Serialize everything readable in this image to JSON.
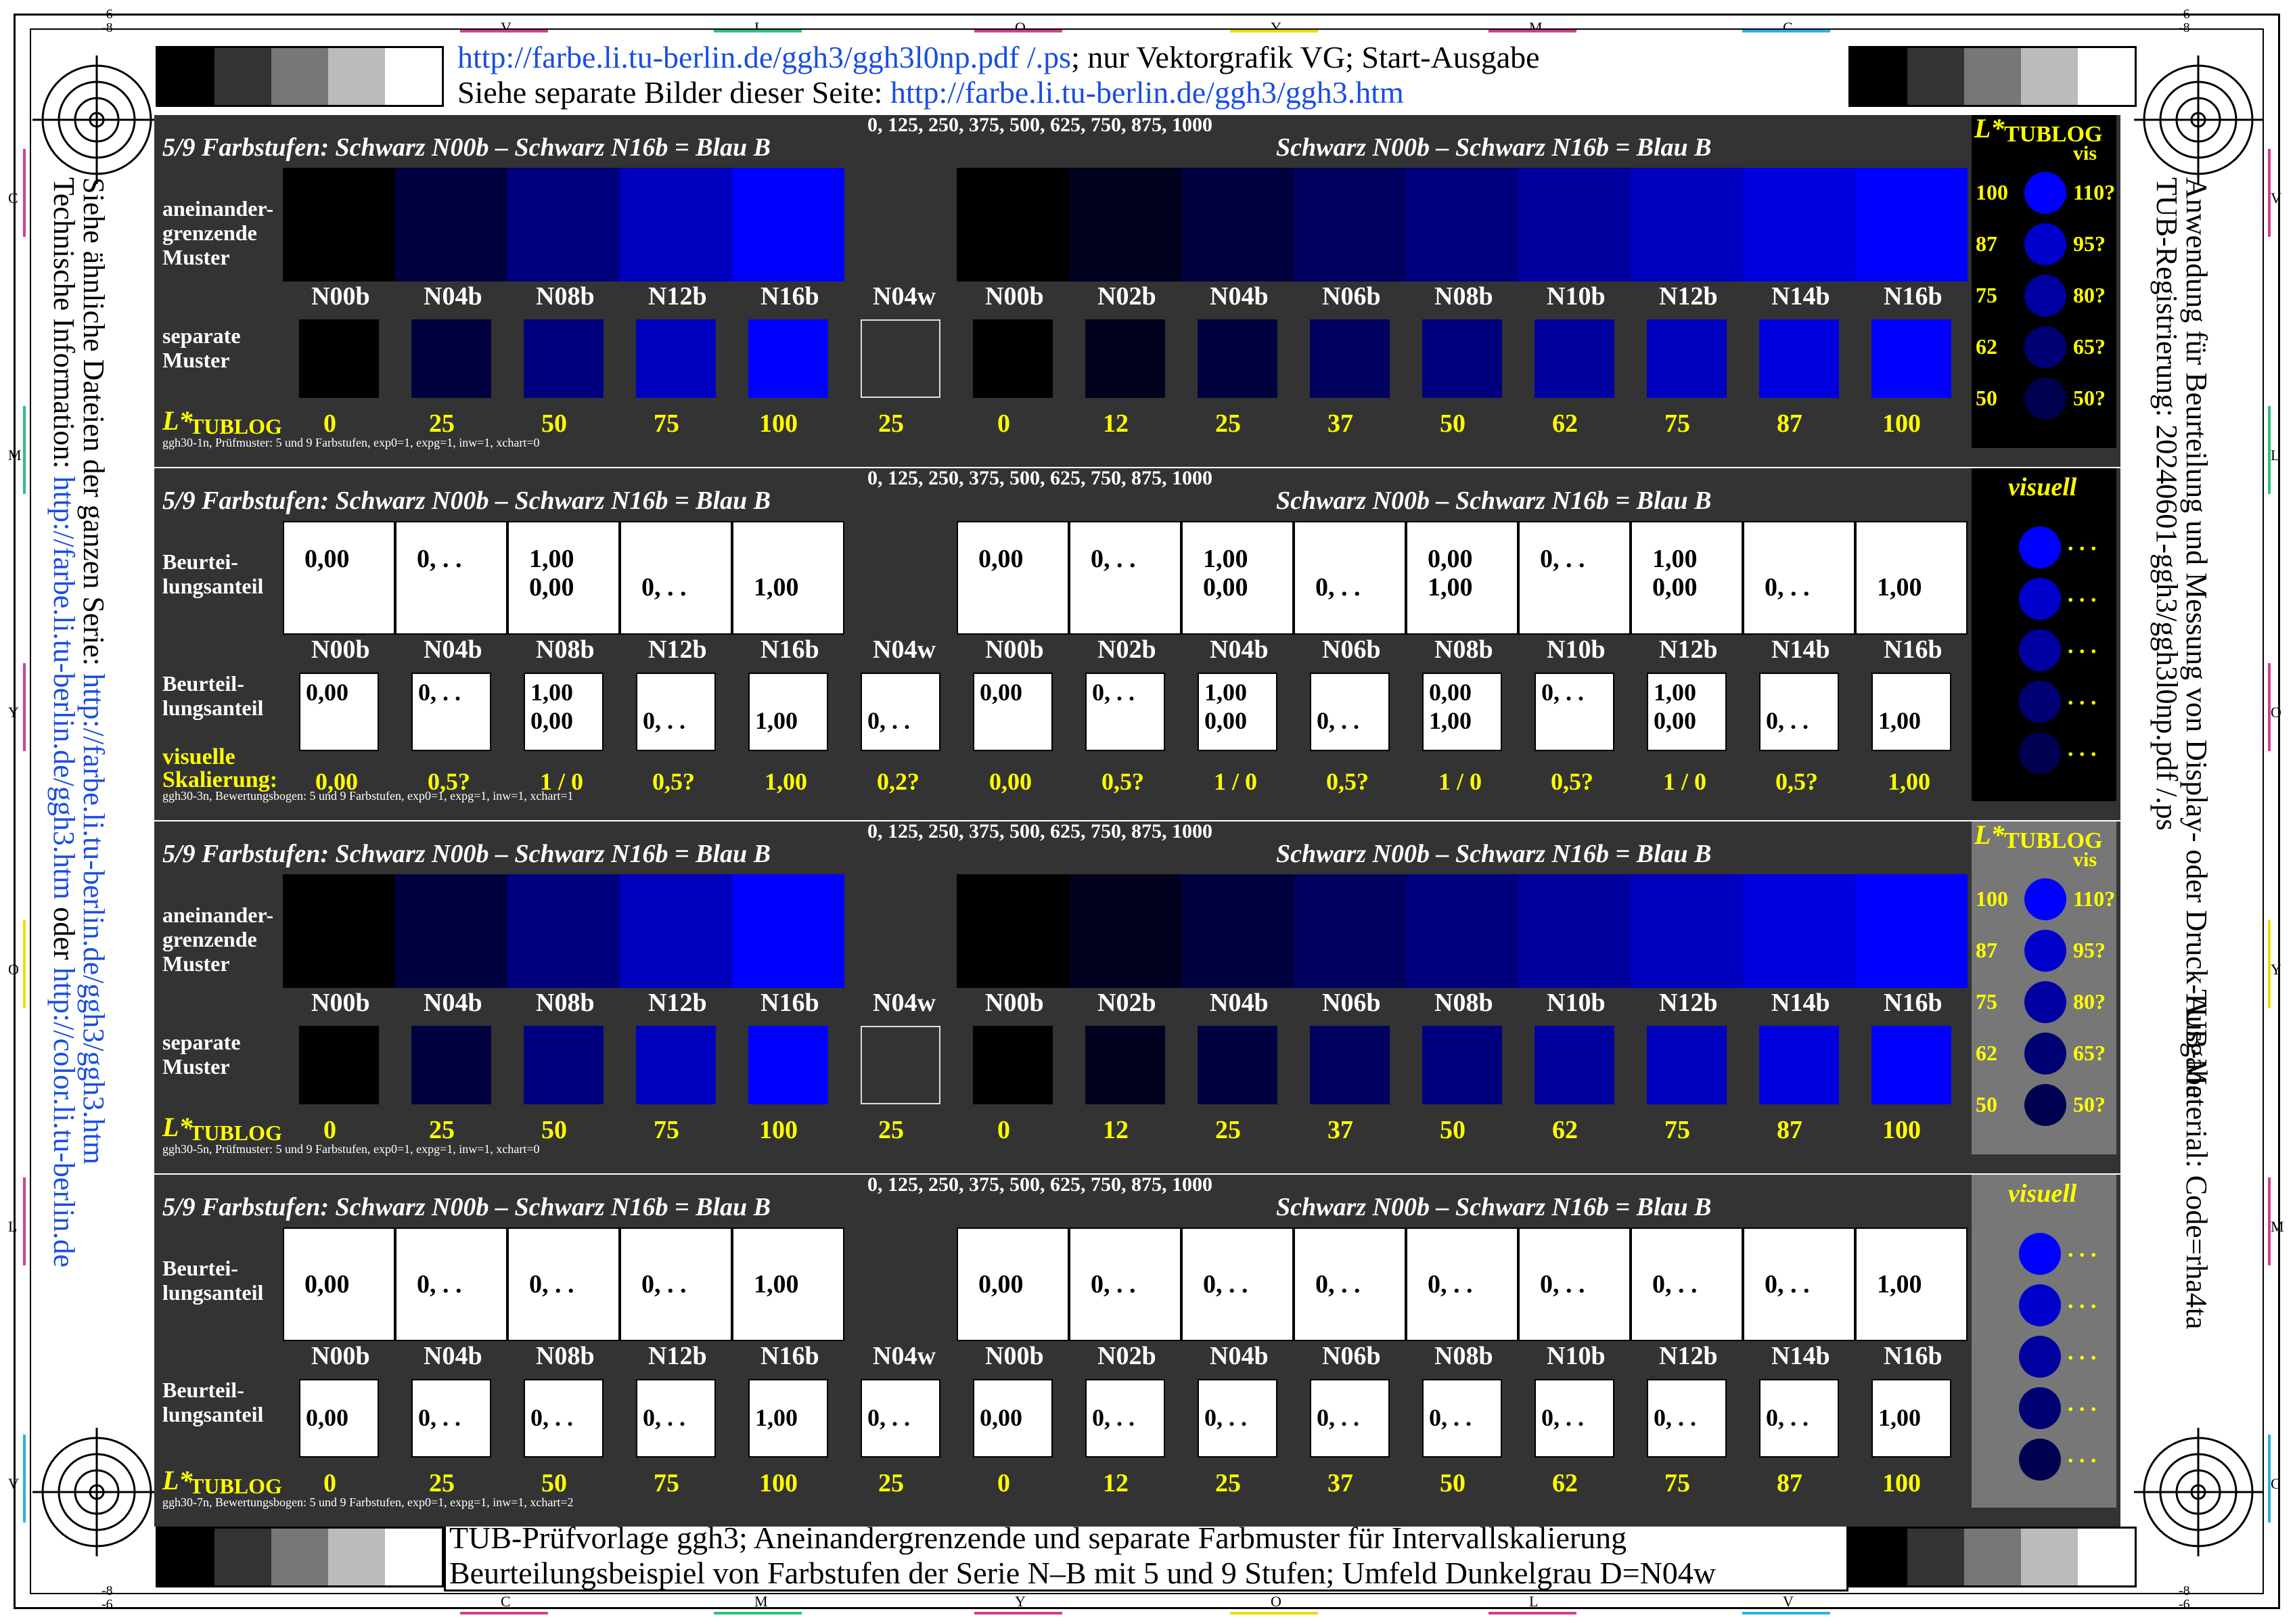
{
  "header": {
    "line1_link": "http://farbe.li.tu-berlin.de/ggh3/ggh3l0np.pdf /.ps",
    "line1_rest": "; nur Vektorgrafik VG; Start-Ausgabe",
    "line2_pre": "Siehe separate Bilder dieser Seite: ",
    "line2_link": "http://farbe.li.tu-berlin.de/ggh3/ggh3.htm"
  },
  "footer": {
    "line1": "TUB-Prüfvorlage ggh3; Aneinandergrenzende und separate Farbmuster für Intervallskalierung",
    "line2": "Beurteilungsbeispiel von Farbstufen der Serie N–B mit 5 und 9 Stufen; Umfeld Dunkelgrau D=N04w"
  },
  "left_text": {
    "line1_pre": "Siehe ähnliche Dateien der ganzen Serie: ",
    "line1_link": "http://farbe.li.tu-berlin.de/ggh3/ggh3.htm",
    "line2_pre": "Technische Information: ",
    "line2_link1": "http://farbe.li.tu-berlin.de/ggh3.htm",
    "line2_mid": " oder ",
    "line2_link2": "http://color.li.tu-berlin.de"
  },
  "right_text": {
    "line1": "TUB-Registrierung: 20240601-ggh3/ggh3l0np.pdf /.ps",
    "line2": "Anwendung für Beurteilung und Messung von Display- oder Druck-Ausgabe",
    "line3": "TUB-Material: Code=rha4ta"
  },
  "top_letters": [
    "V",
    "L",
    "O",
    "Y",
    "M",
    "C"
  ],
  "bottom_letters": [
    "C",
    "M",
    "Y",
    "O",
    "L",
    "V"
  ],
  "side_letters_left": [
    "C",
    "M",
    "Y",
    "O",
    "L",
    "V"
  ],
  "side_letters_right": [
    "V",
    "L",
    "O",
    "Y",
    "M",
    "C"
  ],
  "corner_marks": {
    "top": "-6",
    "top2": "-8"
  },
  "common": {
    "title_left": "5/9 Farbstufen:  Schwarz N00b – Schwarz N16b = Blau B",
    "title_right": "Schwarz N00b – Schwarz N16b = Blau B",
    "scale": "0, 125, 250, 375, 500, 625, 750, 875, 1000",
    "codes": [
      "N00b",
      "N04b",
      "N08b",
      "N12b",
      "N16b",
      "N04w",
      "N00b",
      "N02b",
      "N04b",
      "N06b",
      "N08b",
      "N10b",
      "N12b",
      "N14b",
      "N16b"
    ],
    "lvalues": [
      "0",
      "25",
      "50",
      "75",
      "100",
      "25",
      "0",
      "12",
      "25",
      "37",
      "50",
      "62",
      "75",
      "87",
      "100"
    ],
    "label_adjacent": [
      "aneinander-",
      "grenzende",
      "Muster"
    ],
    "label_separate": [
      "separate",
      "Muster"
    ],
    "label_judge": [
      "Beurtei-",
      "lungsanteil"
    ],
    "label_judge2": [
      "Beurteil-",
      "lungsanteil"
    ],
    "lstar": "L*",
    "tublog": "TUBLOG",
    "side_title": "TUBLOG",
    "side_vis": "vis",
    "side_left": [
      "100",
      "87",
      "75",
      "62",
      "50"
    ],
    "side_right": [
      "110?",
      "95?",
      "80?",
      "65?",
      "50?"
    ],
    "visuell": "visuell",
    "dots": ". . ."
  },
  "colors": {
    "steps5": [
      "#000000",
      "#00003f",
      "#00007f",
      "#0000bf",
      "#0000ff"
    ],
    "steps9": [
      "#000000",
      "#00001f",
      "#00003f",
      "#00005f",
      "#00007f",
      "#00009f",
      "#0000bf",
      "#0000df",
      "#0000ff"
    ],
    "surround": "#333333",
    "side_dots_1": [
      "#0000ff",
      "#0000cc",
      "#0000a0",
      "#000075",
      "#000050"
    ],
    "side_dots_3": [
      "#0000ff",
      "#0000cc",
      "#0000a0",
      "#000075",
      "#000050"
    ]
  },
  "panels": [
    {
      "id": "p1",
      "footer": "ggh30-1n, Prüfmuster: 5 und 9 Farbstufen, exp0=1, expg=1, inw=1, xchart=0"
    },
    {
      "id": "p2",
      "footer": "ggh30-3n, Bewertungsbogen: 5 und 9 Farbstufen, exp0=1, expg=1, inw=1, xchart=1",
      "top_values": [
        [
          "0,00"
        ],
        [
          "0, . ."
        ],
        [
          "1,00",
          "0,00"
        ],
        [
          "",
          "0, . ."
        ],
        [
          "",
          "1,00"
        ],
        [],
        [
          "0,00"
        ],
        [
          "0, . ."
        ],
        [
          "1,00",
          "0,00"
        ],
        [
          "",
          "0, . ."
        ],
        [
          "0,00",
          "1,00"
        ],
        [
          "0, . ."
        ],
        [
          "1,00",
          "0,00"
        ],
        [
          "",
          "0, . ."
        ],
        [
          "",
          "1,00"
        ]
      ],
      "bottom_values": [
        [
          "0,00"
        ],
        [
          "0, . ."
        ],
        [
          "1,00",
          "0,00"
        ],
        [
          "",
          "0, . ."
        ],
        [
          "",
          "1,00"
        ],
        [
          "",
          "0, . ."
        ],
        [
          "0,00"
        ],
        [
          "0, . ."
        ],
        [
          "1,00",
          "0,00"
        ],
        [
          "",
          "0, . ."
        ],
        [
          "0,00",
          "1,00"
        ],
        [
          "0, . ."
        ],
        [
          "1,00",
          "0,00"
        ],
        [
          "",
          "0, . ."
        ],
        [
          "",
          "1,00"
        ]
      ],
      "visuelle": "visuelle",
      "skal_label": "Skalierung:",
      "skal": [
        "0,00",
        "0,5?",
        "1 / 0",
        "0,5?",
        "1,00",
        "0,2?",
        "0,00",
        "0,5?",
        "1 / 0",
        "0,5?",
        "1 / 0",
        "0,5?",
        "1 / 0",
        "0,5?",
        "1,00"
      ]
    },
    {
      "id": "p3",
      "footer": "ggh30-5n, Prüfmuster: 5 und 9 Farbstufen, exp0=1, expg=1, inw=1, xchart=0"
    },
    {
      "id": "p4",
      "footer": "ggh30-7n, Bewertungsbogen: 5 und 9 Farbstufen, exp0=1, expg=1, inw=1, xchart=2",
      "top_values": [
        "0,00",
        "0, . .",
        "0, . .",
        "0, . .",
        "1,00",
        "",
        "0,00",
        "0, . .",
        "0, . .",
        "0, . .",
        "0, . .",
        "0, . .",
        "0, . .",
        "0, . .",
        "1,00"
      ],
      "bottom_values": [
        "0,00",
        "0, . .",
        "0, . .",
        "0, . .",
        "1,00",
        "0, . .",
        "0,00",
        "0, . .",
        "0, . .",
        "0, . .",
        "0, . .",
        "0, . .",
        "0, . .",
        "0, . .",
        "1,00"
      ]
    }
  ]
}
